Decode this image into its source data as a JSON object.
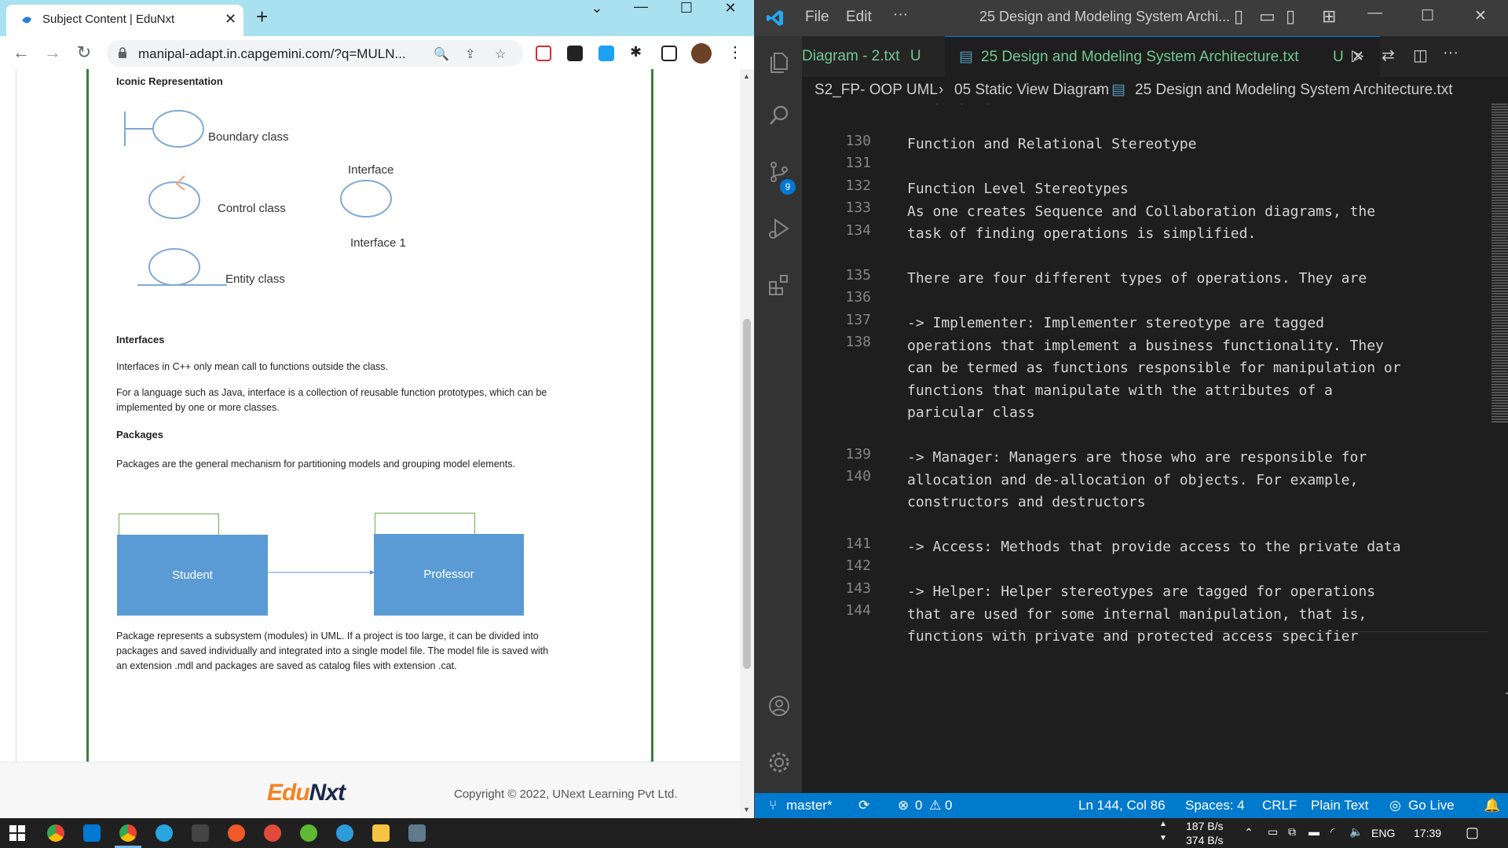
{
  "browser": {
    "tab_title": "Subject Content | EduNxt",
    "new_tab": "+",
    "url": "manipal-adapt.in.capgemini.com/?q=MULN...",
    "window_controls": [
      "chevron-down-icon",
      "minimize-icon",
      "maximize-icon",
      "close-icon"
    ]
  },
  "page": {
    "iconic_heading": "Iconic Representation",
    "boundary_label": "Boundary class",
    "interface_label": "Interface",
    "control_label": "Control class",
    "interface1_label": "Interface 1",
    "entity_label": "Entity class",
    "interfaces_heading": "Interfaces",
    "interfaces_p1": "Interfaces in C++ only mean call to functions outside the class.",
    "interfaces_p2a": "For a language such as Java, interface is a collection of reusable function prototypes, which can be",
    "interfaces_p2b": "implemented by one or more classes.",
    "packages_heading": "Packages",
    "packages_p1": "Packages are the general mechanism for partitioning models and grouping model elements.",
    "pkg_student": "Student",
    "pkg_professor": "Professor",
    "pkg_p2a": "Package represents a subsystem (modules) in UML. If a project is too large, it can be divided into",
    "pkg_p2b": "packages and saved individually and integrated into a single model file. The model file is saved with",
    "pkg_p2c": "an extension .mdl and packages are saved as catalog files with extension .cat.",
    "logo_a": "Edu",
    "logo_b": "Nxt",
    "copyright": "Copyright © 2022, UNext Learning Pvt Ltd."
  },
  "vscode": {
    "menu_file": "File",
    "menu_edit": "Edit",
    "menu_more": "···",
    "window_title": "25 Design and Modeling System Archi...",
    "tab1": "Diagram - 2.txt",
    "tab1_status": "U",
    "tab2": "25 Design and Modeling System Architecture.txt",
    "tab2_status": "U",
    "breadcrumb_1": "S2_FP- OOP UML",
    "breadcrumb_2": "05 Static View Diagram",
    "breadcrumb_3": "25 Design and Modeling System Architecture.txt",
    "source_control_badge": "9",
    "lines": [
      {
        "n": "",
        "t": "information"
      },
      {
        "n": "130",
        "t": ""
      },
      {
        "n": "131",
        "t": "Function and Relational Stereotype"
      },
      {
        "n": "132",
        "t": ""
      },
      {
        "n": "133",
        "t": "Function Level Stereotypes"
      },
      {
        "n": "134",
        "t": "As one creates Sequence and Collaboration diagrams, the"
      },
      {
        "n": "",
        "t": "task of finding operations is simplified."
      },
      {
        "n": "135",
        "t": ""
      },
      {
        "n": "136",
        "t": "There are four different types of operations. They are"
      },
      {
        "n": "137",
        "t": ""
      },
      {
        "n": "138",
        "t": "-> Implementer: Implementer stereotype are tagged"
      },
      {
        "n": "",
        "t": "operations that implement a business functionality. They"
      },
      {
        "n": "",
        "t": "can be termed as functions responsible for manipulation or"
      },
      {
        "n": "",
        "t": "functions that manipulate with the attributes of a"
      },
      {
        "n": "",
        "t": "paricular class"
      },
      {
        "n": "139",
        "t": ""
      },
      {
        "n": "140",
        "t": "-> Manager: Managers are those who are responsible for"
      },
      {
        "n": "",
        "t": "allocation and de-allocation of objects. For example,"
      },
      {
        "n": "",
        "t": "constructors and destructors"
      },
      {
        "n": "141",
        "t": ""
      },
      {
        "n": "142",
        "t": "-> Access: Methods that provide access to the private data"
      },
      {
        "n": "143",
        "t": ""
      },
      {
        "n": "144",
        "t": "-> Helper: Helper stereotypes are tagged for operations"
      },
      {
        "n": "",
        "t": "that are used for some internal manipulation, that is,"
      },
      {
        "n": "",
        "t": "functions with private and protected access specifier"
      }
    ],
    "status": {
      "branch": "master*",
      "errors": "0",
      "warnings": "0",
      "position": "Ln 144, Col 86",
      "spaces": "Spaces: 4",
      "eol": "CRLF",
      "language": "Plain Text",
      "golive": "Go Live"
    }
  },
  "taskbar": {
    "net_up": "187 B/s",
    "net_down": "374 B/s",
    "lang": "ENG",
    "time": "17:39"
  },
  "colors": {
    "vscode_accent": "#007acc",
    "package_blue": "#5b9bd5",
    "chrome_tabbar": "#a9e1f0",
    "logo_orange": "#f58220"
  }
}
